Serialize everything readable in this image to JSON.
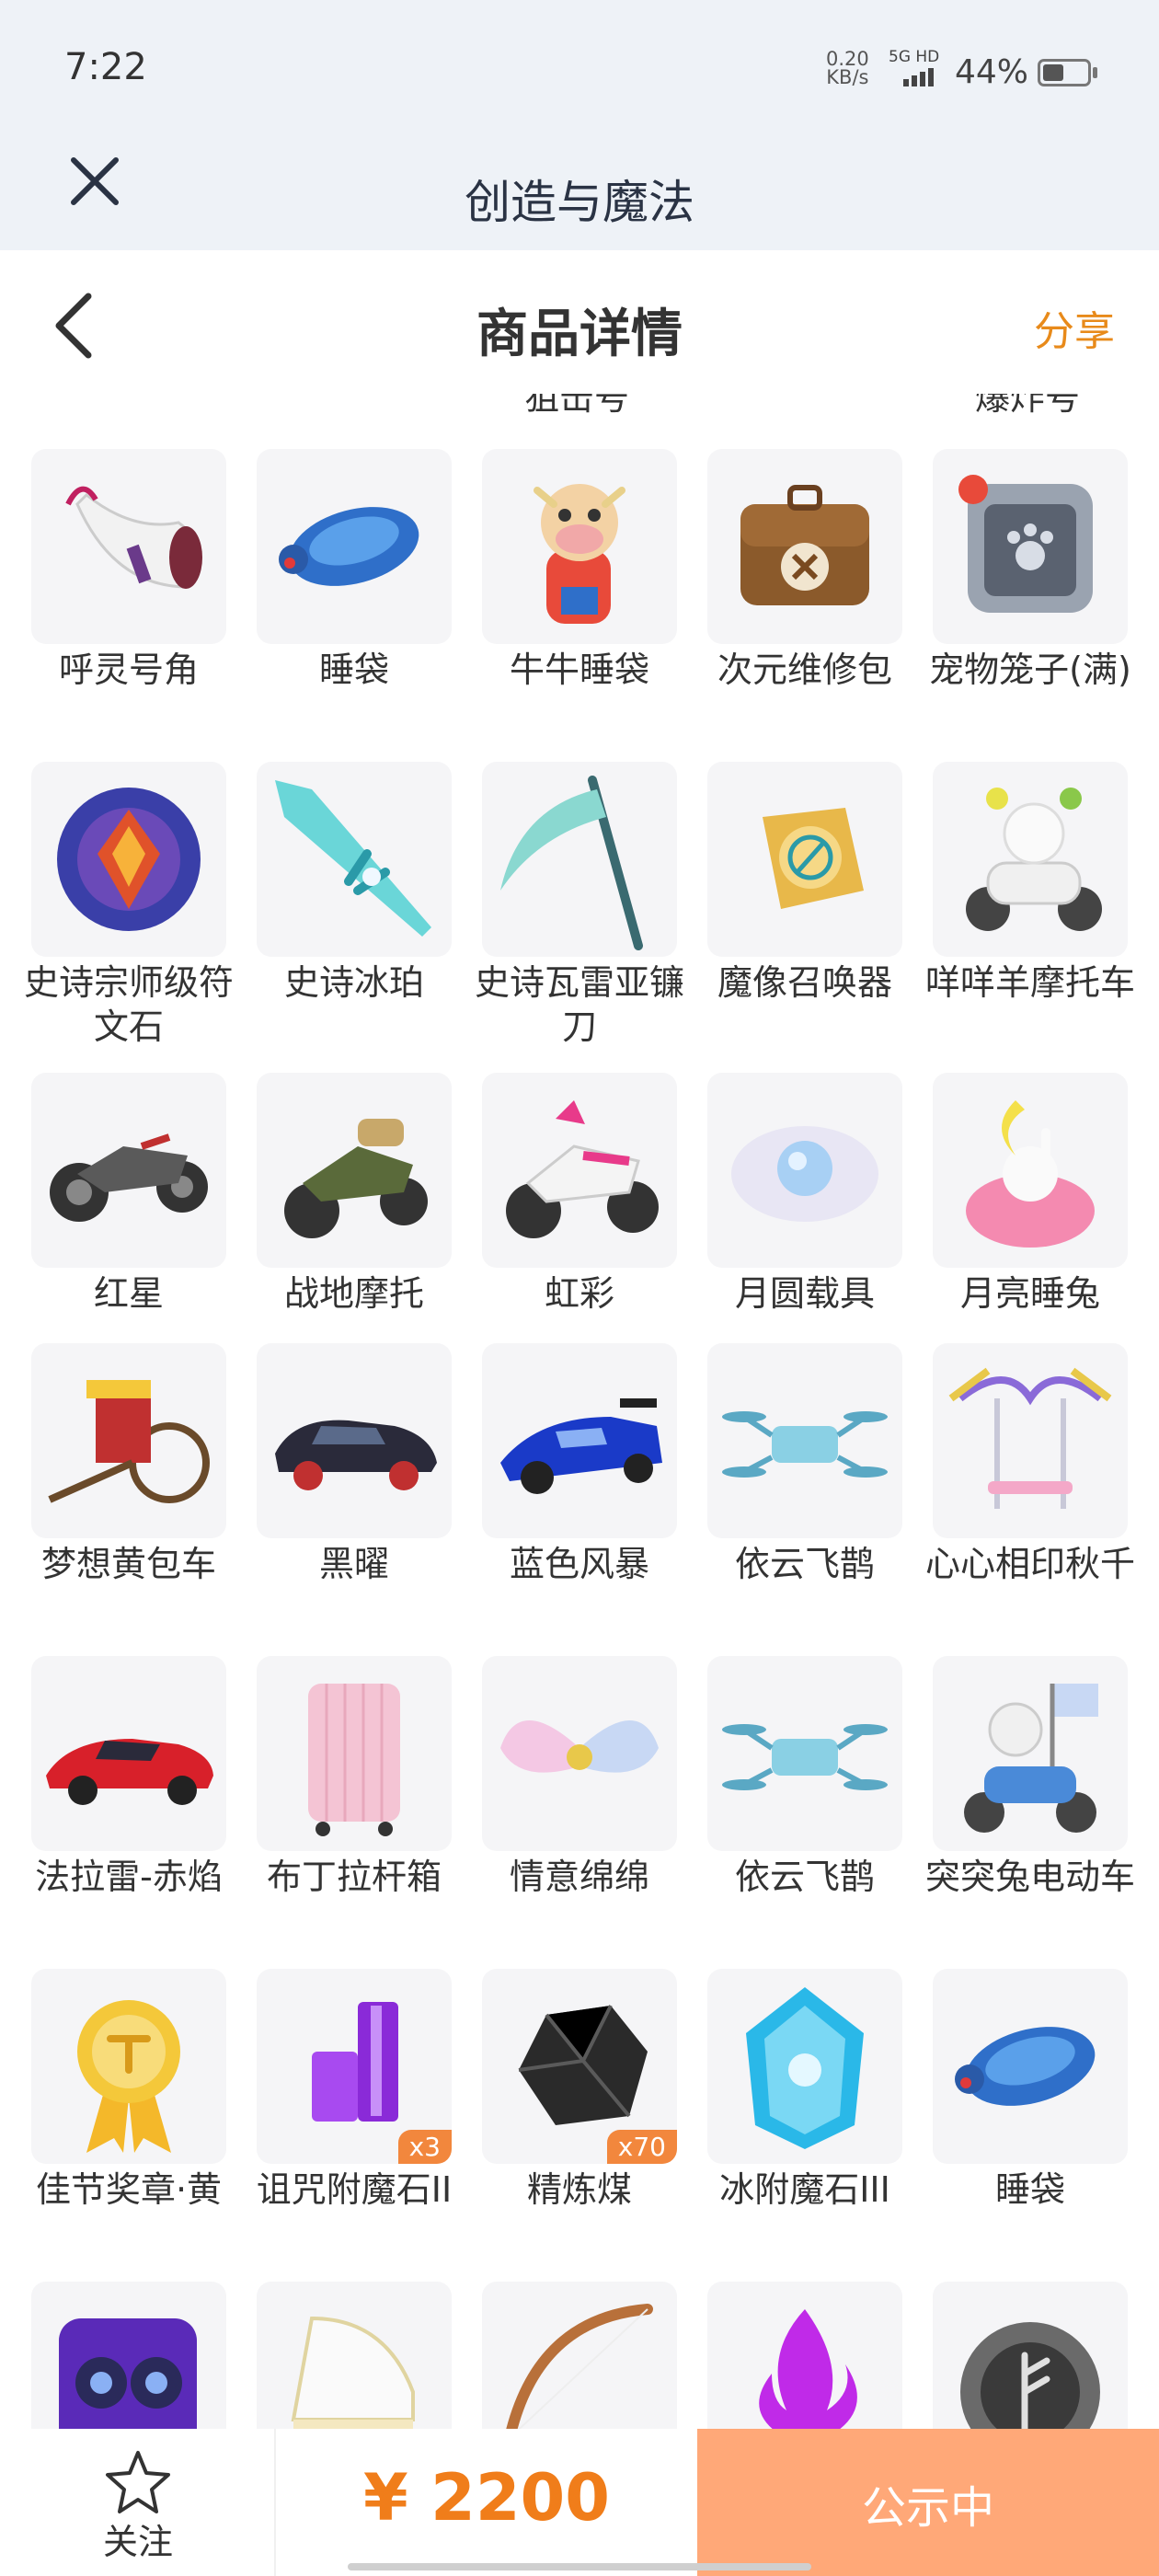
{
  "status_bar": {
    "time": "7:22",
    "net_speed_value": "0.20",
    "net_speed_unit": "KB/s",
    "network": "5G HD",
    "battery": "44%"
  },
  "app": {
    "title": "创造与魔法"
  },
  "header": {
    "title": "商品详情",
    "share_label": "分享"
  },
  "partial_labels": [
    "狙击号",
    "爆炸号"
  ],
  "items": [
    {
      "name": "呼灵号角",
      "icon": "horn-icon"
    },
    {
      "name": "睡袋",
      "icon": "sleeping-bag-turtle-icon"
    },
    {
      "name": "牛牛睡袋",
      "icon": "cow-sleeping-bag-icon"
    },
    {
      "name": "次元维修包",
      "icon": "repair-bag-icon"
    },
    {
      "name": "宠物笼子(满)",
      "icon": "pet-cage-icon"
    },
    {
      "name": "史诗宗师级符文石",
      "icon": "rune-stone-icon"
    },
    {
      "name": "史诗冰珀",
      "icon": "ice-sword-icon"
    },
    {
      "name": "史诗瓦雷亚镰刀",
      "icon": "scythe-icon"
    },
    {
      "name": "魔像召唤器",
      "icon": "golem-summoner-icon"
    },
    {
      "name": "咩咩羊摩托车",
      "icon": "sheep-scooter-icon"
    },
    {
      "name": "红星",
      "icon": "motorbike-icon"
    },
    {
      "name": "战地摩托",
      "icon": "army-motorbike-icon"
    },
    {
      "name": "虹彩",
      "icon": "rainbow-motorbike-icon"
    },
    {
      "name": "月圆载具",
      "icon": "moon-cloud-icon"
    },
    {
      "name": "月亮睡兔",
      "icon": "moon-rabbit-icon"
    },
    {
      "name": "梦想黄包车",
      "icon": "rickshaw-icon"
    },
    {
      "name": "黑曜",
      "icon": "black-car-icon"
    },
    {
      "name": "蓝色风暴",
      "icon": "blue-racecar-icon"
    },
    {
      "name": "依云飞鹊",
      "icon": "drone-icon"
    },
    {
      "name": "心心相印秋千",
      "icon": "swing-icon"
    },
    {
      "name": "法拉雷-赤焰",
      "icon": "red-sportscar-icon"
    },
    {
      "name": "布丁拉杆箱",
      "icon": "suitcase-icon"
    },
    {
      "name": "情意绵绵",
      "icon": "wings-icon"
    },
    {
      "name": "依云飞鹊",
      "icon": "drone-icon"
    },
    {
      "name": "突突兔电动车",
      "icon": "rabbit-scooter-icon"
    },
    {
      "name": "佳节奖章·黄",
      "icon": "medal-icon"
    },
    {
      "name": "诅咒附魔石II",
      "icon": "purple-crystal-icon",
      "qty": "x3"
    },
    {
      "name": "精炼煤",
      "icon": "coal-icon",
      "qty": "x70"
    },
    {
      "name": "冰附魔石III",
      "icon": "ice-crystal-icon"
    },
    {
      "name": "睡袋",
      "icon": "sleeping-bag-turtle-icon"
    },
    {
      "name": "",
      "icon": "speaker-icon"
    },
    {
      "name": "",
      "icon": "piano-icon"
    },
    {
      "name": "",
      "icon": "bow-icon"
    },
    {
      "name": "",
      "icon": "purple-fire-icon"
    },
    {
      "name": "",
      "icon": "rune-disc-icon"
    }
  ],
  "bottom": {
    "follow_label": "关注",
    "price": "¥ 2200",
    "status_label": "公示中"
  },
  "colors": {
    "accent": "#f07d1a",
    "status_button": "#ffa878",
    "header_bg": "#eef2f7"
  }
}
